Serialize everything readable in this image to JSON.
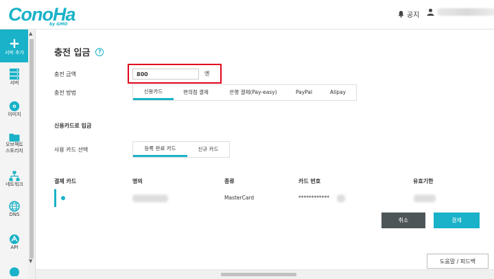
{
  "header": {
    "logo": "ConoHa",
    "logo_sub": "by GMO",
    "notice_label": "공지"
  },
  "sidebar": {
    "items": [
      {
        "label": "서버 추가",
        "icon": "plus-icon"
      },
      {
        "label": "서버",
        "icon": "server-icon"
      },
      {
        "label": "이미지",
        "icon": "image-icon"
      },
      {
        "label": "오브젝트\n스토리지",
        "icon": "folder-icon"
      },
      {
        "label": "네트워크",
        "icon": "network-icon"
      },
      {
        "label": "DNS",
        "icon": "globe-icon"
      },
      {
        "label": "API",
        "icon": "api-icon"
      }
    ]
  },
  "page": {
    "title": "충전 입금",
    "amount_label": "충전 금액",
    "amount_value": "800",
    "amount_unit": "엔",
    "method_label": "충전 방법",
    "methods": [
      "신용카드",
      "편의점 결제",
      "은행 결제(Pay-easy)",
      "PayPal",
      "Alipay"
    ],
    "card_section_title": "신용카드로 입금",
    "card_select_label": "사용 카드 선택",
    "card_tabs": [
      "등록 완료 카드",
      "신규 카드"
    ],
    "table": {
      "headers": [
        "결제 카드",
        "명의",
        "종류",
        "카드 번호",
        "유효기한"
      ],
      "row": {
        "type": "MasterCard",
        "number": "************"
      }
    },
    "cancel_label": "취소",
    "pay_label": "결제",
    "feedback_label": "도움말 / 피드백"
  },
  "colors": {
    "accent": "#19b2c8",
    "highlight": "#e0001b",
    "cancel": "#4d5559"
  }
}
